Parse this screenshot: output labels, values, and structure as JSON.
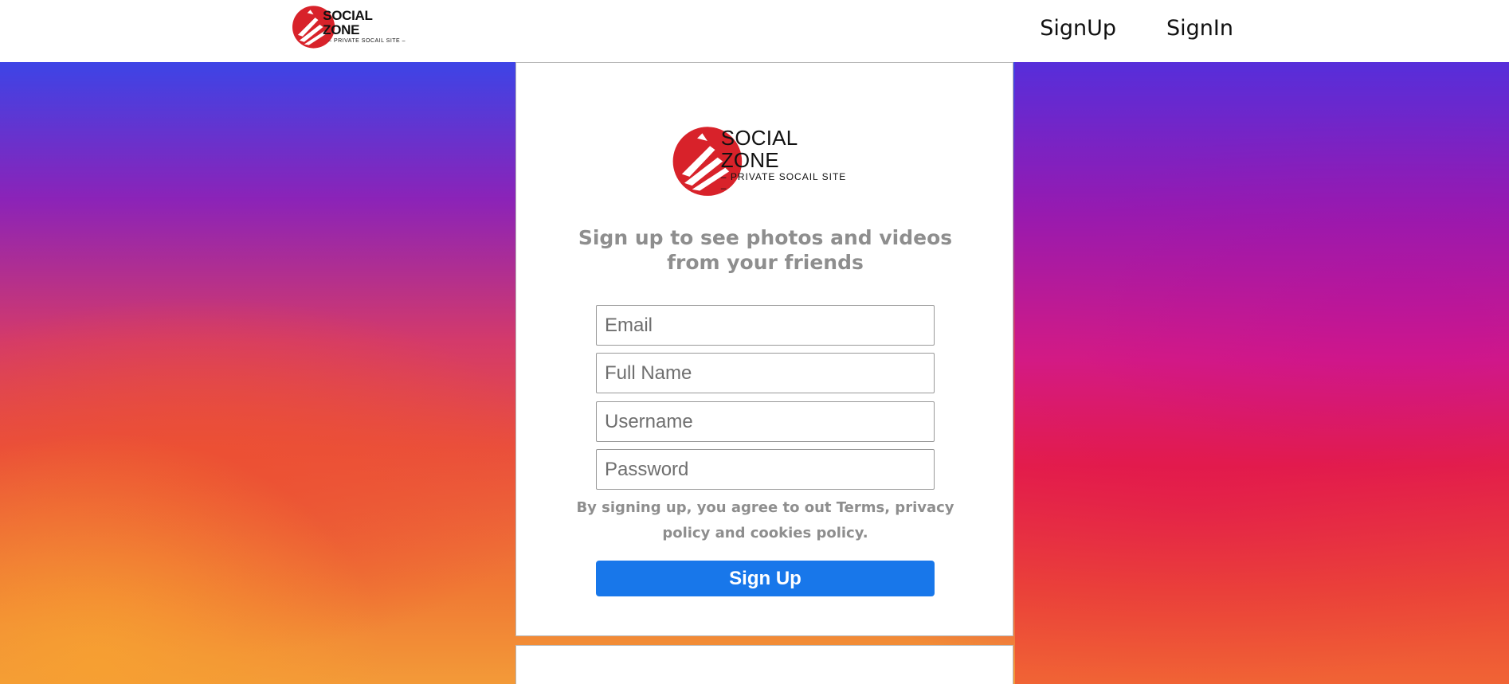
{
  "brand": {
    "name": "SOCIAL ZONE",
    "subtitle": "PRIVATE SOCAIL SITE",
    "accent_color": "#d8222a"
  },
  "nav": {
    "signup_label": "SignUp",
    "signin_label": "SignIn"
  },
  "signup_card": {
    "tagline": "Sign up to see photos and videos from your friends",
    "fields": {
      "email_placeholder": "Email",
      "fullname_placeholder": "Full Name",
      "username_placeholder": "Username",
      "password_placeholder": "Password"
    },
    "terms_text": "By signing up, you agree to out Terms, privacy policy and cookies policy.",
    "submit_label": "Sign Up",
    "submit_color": "#1877ea"
  }
}
